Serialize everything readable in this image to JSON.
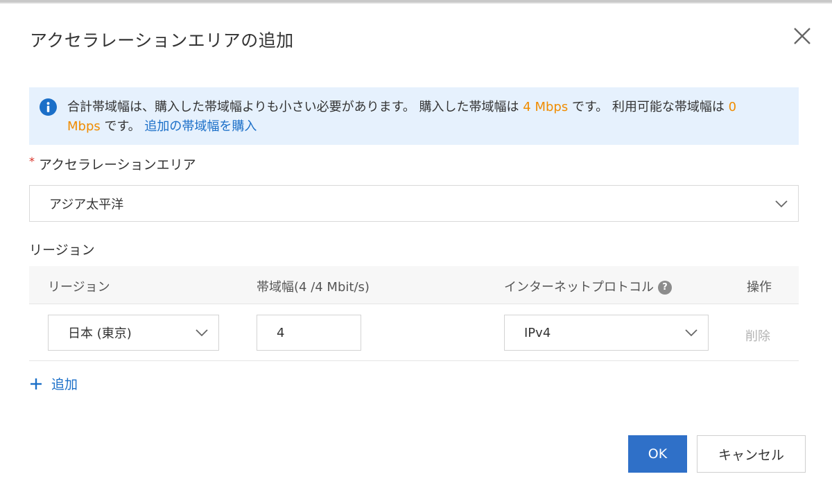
{
  "dialog": {
    "title": "アクセラレーションエリアの追加"
  },
  "notice": {
    "text1": "合計帯域幅は、購入した帯域幅よりも小さい必要があります。 購入した帯域幅は ",
    "purchased": "4 Mbps",
    "text2": " です。 利用可能な帯域幅は ",
    "available": "0 Mbps",
    "text3": " です。 ",
    "link": "追加の帯域幅を購入"
  },
  "area": {
    "required_mark": "*",
    "label": "アクセラレーションエリア",
    "value": "アジア太平洋"
  },
  "region": {
    "section_label": "リージョン",
    "columns": {
      "region": "リージョン",
      "bandwidth": "帯域幅(4 /4 Mbit/s)",
      "protocol": "インターネットプロトコル",
      "action": "操作"
    },
    "rows": [
      {
        "region": "日本 (東京)",
        "bandwidth": "4",
        "protocol": "IPv4",
        "delete": "削除"
      }
    ],
    "add_label": "追加"
  },
  "buttons": {
    "ok": "OK",
    "cancel": "キャンセル"
  },
  "colors": {
    "accent": "#2f70c8",
    "link": "#1b6fc8",
    "highlight": "#f08c00",
    "notice_bg": "#e6f1fd"
  }
}
